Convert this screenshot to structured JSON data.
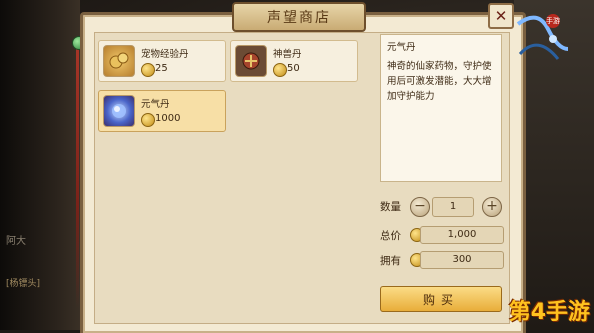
{
  "shop": {
    "title": "声望商店",
    "close_glyph": "✕"
  },
  "items": [
    {
      "name": "宠物经验丹",
      "price": "25",
      "icon": "pet-exp-pill-icon",
      "selected": false
    },
    {
      "name": "神兽丹",
      "price": "50",
      "icon": "divine-beast-pill-icon",
      "selected": false
    },
    {
      "name": "元气丹",
      "price": "1000",
      "icon": "vitality-pill-icon",
      "selected": true
    }
  ],
  "detail": {
    "title": "元气丹",
    "description": "神奇的仙家药物，守护使用后可激发潜能，大大增加守护能力"
  },
  "purchase": {
    "quantity_label": "数量",
    "quantity": "1",
    "minus_glyph": "−",
    "plus_glyph": "+",
    "total_label": "总价",
    "total": "1,000",
    "owned_label": "拥有",
    "owned": "300",
    "buy_label": "购买"
  },
  "logo": {
    "tag": "手游"
  },
  "watermark": "第4手游",
  "background": {
    "left_text_1": "阿大",
    "left_text_2": "[杨镖头]"
  },
  "colors": {
    "panel": "#f3ead3",
    "selected_card": "#f7dfa6",
    "buy_button": "#e8ad3a",
    "border": "#7a6040"
  }
}
